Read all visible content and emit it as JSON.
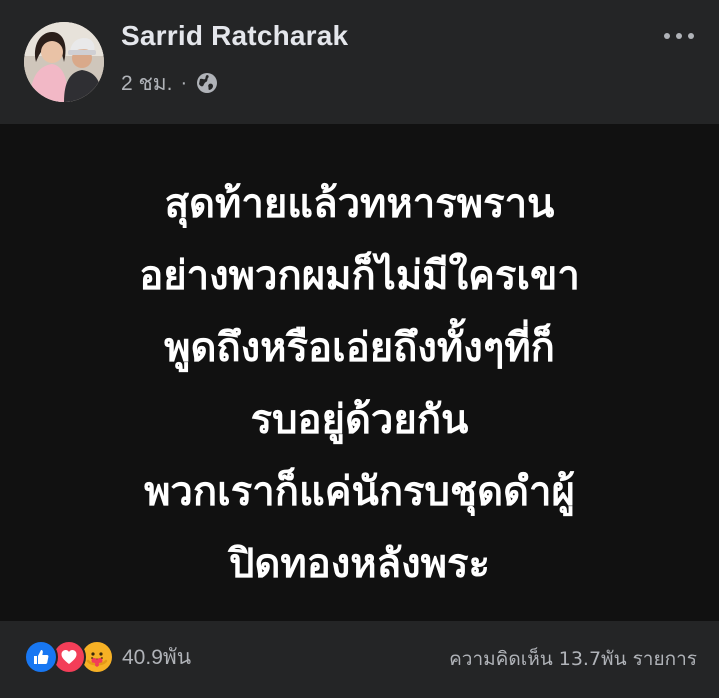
{
  "post": {
    "author": "Sarrid Ratcharak",
    "timestamp": "2 ชม.",
    "separator": "·",
    "audience_icon": "globe-icon",
    "more_icon": "more-options-icon",
    "lines": [
      "สุดท้ายแล้วทหารพราน",
      "อย่างพวกผมก็ไม่มีใครเขา",
      "พูดถึงหรือเอ่ยถึงทั้งๆที่ก็",
      "รบอยู่ด้วยกัน",
      "พวกเราก็แค่นักรบชุดดำผู้",
      "ปิดทองหลังพระ"
    ]
  },
  "footer": {
    "reactions": [
      "like-icon",
      "love-icon",
      "care-icon"
    ],
    "reaction_count": "40.9พัน",
    "comments": "ความคิดเห็น 13.7พัน รายการ"
  },
  "colors": {
    "surface": "#242526",
    "content_bg": "#111111",
    "primary_text": "#e4e6eb",
    "secondary_text": "#b0b3b8",
    "like": "#1877f2",
    "love": "#f33e58",
    "care": "#f7b125"
  }
}
